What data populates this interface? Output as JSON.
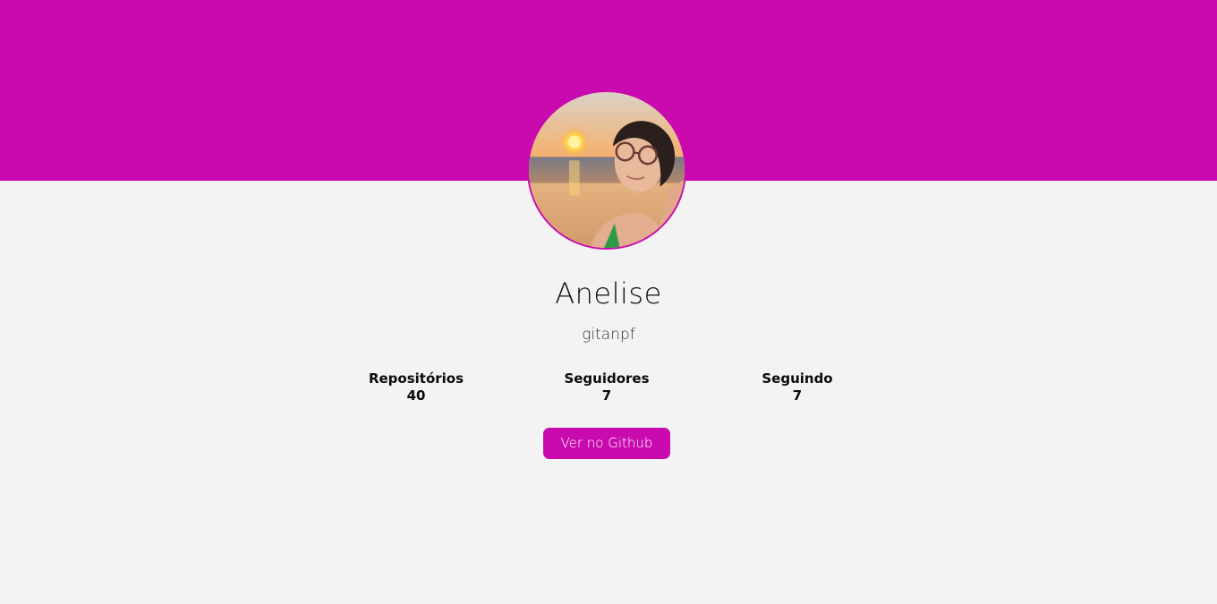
{
  "theme": {
    "accent": "#c80aaf",
    "background": "#f3f3f3"
  },
  "profile": {
    "name": "Anelise",
    "username": "gitanpf",
    "avatar_alt": "Foto de perfil de Anelise"
  },
  "stats": [
    {
      "label": "Repositórios",
      "value": "40"
    },
    {
      "label": "Seguidores",
      "value": "7"
    },
    {
      "label": "Seguindo",
      "value": "7"
    }
  ],
  "actions": {
    "github_button_label": "Ver no Github"
  }
}
